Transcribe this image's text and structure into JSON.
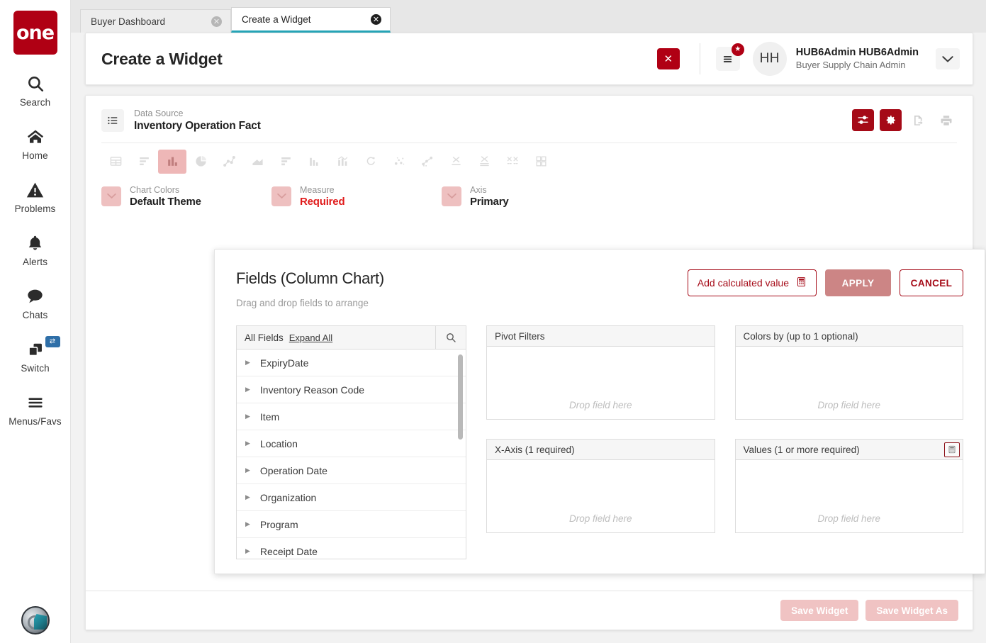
{
  "rail": {
    "logo_text": "one",
    "items": [
      {
        "label": "Search",
        "icon": "search-icon"
      },
      {
        "label": "Home",
        "icon": "home-icon"
      },
      {
        "label": "Problems",
        "icon": "warning-icon"
      },
      {
        "label": "Alerts",
        "icon": "bell-icon"
      },
      {
        "label": "Chats",
        "icon": "chat-icon"
      },
      {
        "label": "Switch",
        "icon": "switch-icon",
        "badge": "⇄"
      },
      {
        "label": "Menus/Favs",
        "icon": "menu-icon"
      }
    ]
  },
  "tabs": [
    {
      "label": "Buyer Dashboard",
      "active": false
    },
    {
      "label": "Create a Widget",
      "active": true
    }
  ],
  "header": {
    "title": "Create a Widget",
    "close_label": "✕",
    "notification_badge": "★",
    "avatar_initials": "HH",
    "user_name": "HUB6Admin HUB6Admin",
    "user_role": "Buyer Supply Chain Admin"
  },
  "datasource": {
    "label": "Data Source",
    "value": "Inventory Operation Fact",
    "actions": [
      {
        "name": "filters-icon",
        "style": "red"
      },
      {
        "name": "settings-gear-icon",
        "style": "red"
      },
      {
        "name": "export-icon",
        "style": "ghost"
      },
      {
        "name": "print-icon",
        "style": "ghost"
      }
    ]
  },
  "chart_types": [
    {
      "name": "table-chart-icon",
      "selected": false
    },
    {
      "name": "horizontal-bar-chart-icon",
      "selected": false
    },
    {
      "name": "column-chart-icon",
      "selected": true
    },
    {
      "name": "pie-chart-icon",
      "selected": false
    },
    {
      "name": "line-chart-icon",
      "selected": false
    },
    {
      "name": "area-chart-icon",
      "selected": false
    },
    {
      "name": "stacked-bar-chart-icon",
      "selected": false
    },
    {
      "name": "grouped-column-chart-icon",
      "selected": false
    },
    {
      "name": "combo-chart-icon",
      "selected": false
    },
    {
      "name": "donut-progress-chart-icon",
      "selected": false
    },
    {
      "name": "bubble-chart-icon",
      "selected": false
    },
    {
      "name": "connected-scatter-chart-icon",
      "selected": false
    },
    {
      "name": "box-plot-chart-icon",
      "selected": false
    },
    {
      "name": "range-chart-icon",
      "selected": false
    },
    {
      "name": "scatter-matrix-chart-icon",
      "selected": false
    },
    {
      "name": "tile-chart-icon",
      "selected": false
    }
  ],
  "options": [
    {
      "label": "Chart Colors",
      "value": "Default Theme",
      "required": false
    },
    {
      "label": "Measure",
      "value": "Required",
      "required": true
    },
    {
      "label": "Axis",
      "value": "Primary",
      "required": false
    }
  ],
  "fields_modal": {
    "title": "Fields (Column Chart)",
    "subtitle": "Drag and drop fields to arrange",
    "add_calculated_label": "Add calculated value",
    "apply_label": "APPLY",
    "cancel_label": "CANCEL",
    "list": {
      "title": "All Fields",
      "expand_all": "Expand All",
      "items": [
        "ExpiryDate",
        "Inventory Reason Code",
        "Item",
        "Location",
        "Operation Date",
        "Organization",
        "Program",
        "Receipt Date"
      ]
    },
    "dropzones": [
      {
        "title": "Pivot Filters",
        "hint": "Drop field here",
        "has_calc_icon": false
      },
      {
        "title": "Colors by (up to 1 optional)",
        "hint": "Drop field here",
        "has_calc_icon": false
      },
      {
        "title": "X-Axis (1 required)",
        "hint": "Drop field here",
        "has_calc_icon": false
      },
      {
        "title": "Values (1 or more required)",
        "hint": "Drop field here",
        "has_calc_icon": true
      }
    ]
  },
  "footer": {
    "save_widget": "Save Widget",
    "save_widget_as": "Save Widget As"
  },
  "colors": {
    "brand_red": "#b00014",
    "action_red": "#a50a17",
    "tab_accent": "#26a5b8",
    "required_red": "#e01b1b",
    "muted_pink": "#eeb7b7"
  }
}
